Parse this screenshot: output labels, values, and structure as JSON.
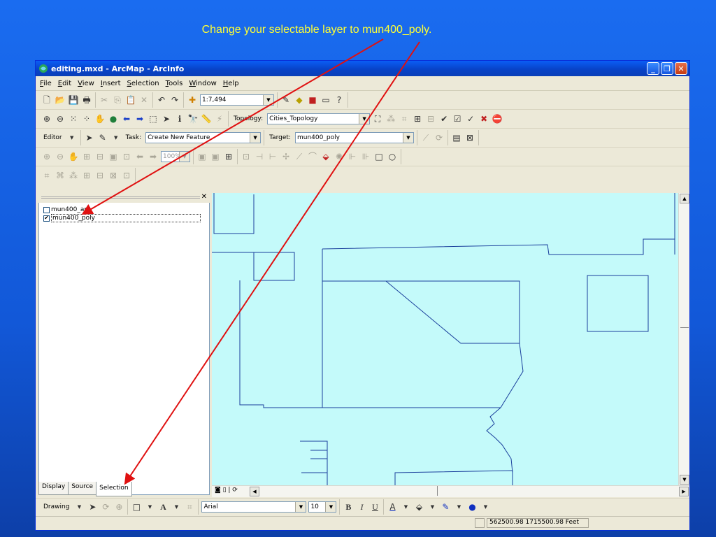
{
  "caption": "Change your selectable layer to mun400_poly.",
  "window": {
    "title": "editing.mxd - ArcMap - ArcInfo"
  },
  "menu": [
    "File",
    "Edit",
    "View",
    "Insert",
    "Selection",
    "Tools",
    "Window",
    "Help"
  ],
  "standard": {
    "scale": "1:7,494"
  },
  "topology": {
    "label": "Topology:",
    "value": "Cities_Topology"
  },
  "editor": {
    "editor_label": "Editor",
    "task_label": "Task:",
    "task_value": "Create New Feature",
    "target_label": "Target:",
    "target_value": "mun400_poly"
  },
  "georef": {
    "zoom": "100%"
  },
  "toc": {
    "layers": [
      {
        "name": "mun400_ara",
        "checked": false
      },
      {
        "name": "mun400_poly",
        "checked": true
      }
    ],
    "tabs": [
      "Display",
      "Source",
      "Selection"
    ]
  },
  "drawing": {
    "label": "Drawing",
    "font": "Arial",
    "size": "10",
    "bold": "B",
    "italic": "I",
    "underline": "U"
  },
  "status": {
    "coordinates": "562500.98  1715500.98 Feet"
  },
  "colors": {
    "caption": "#ffff33",
    "map_bg": "#c4fafa",
    "arrow": "#e01010",
    "lines": "#1a3f9c"
  }
}
